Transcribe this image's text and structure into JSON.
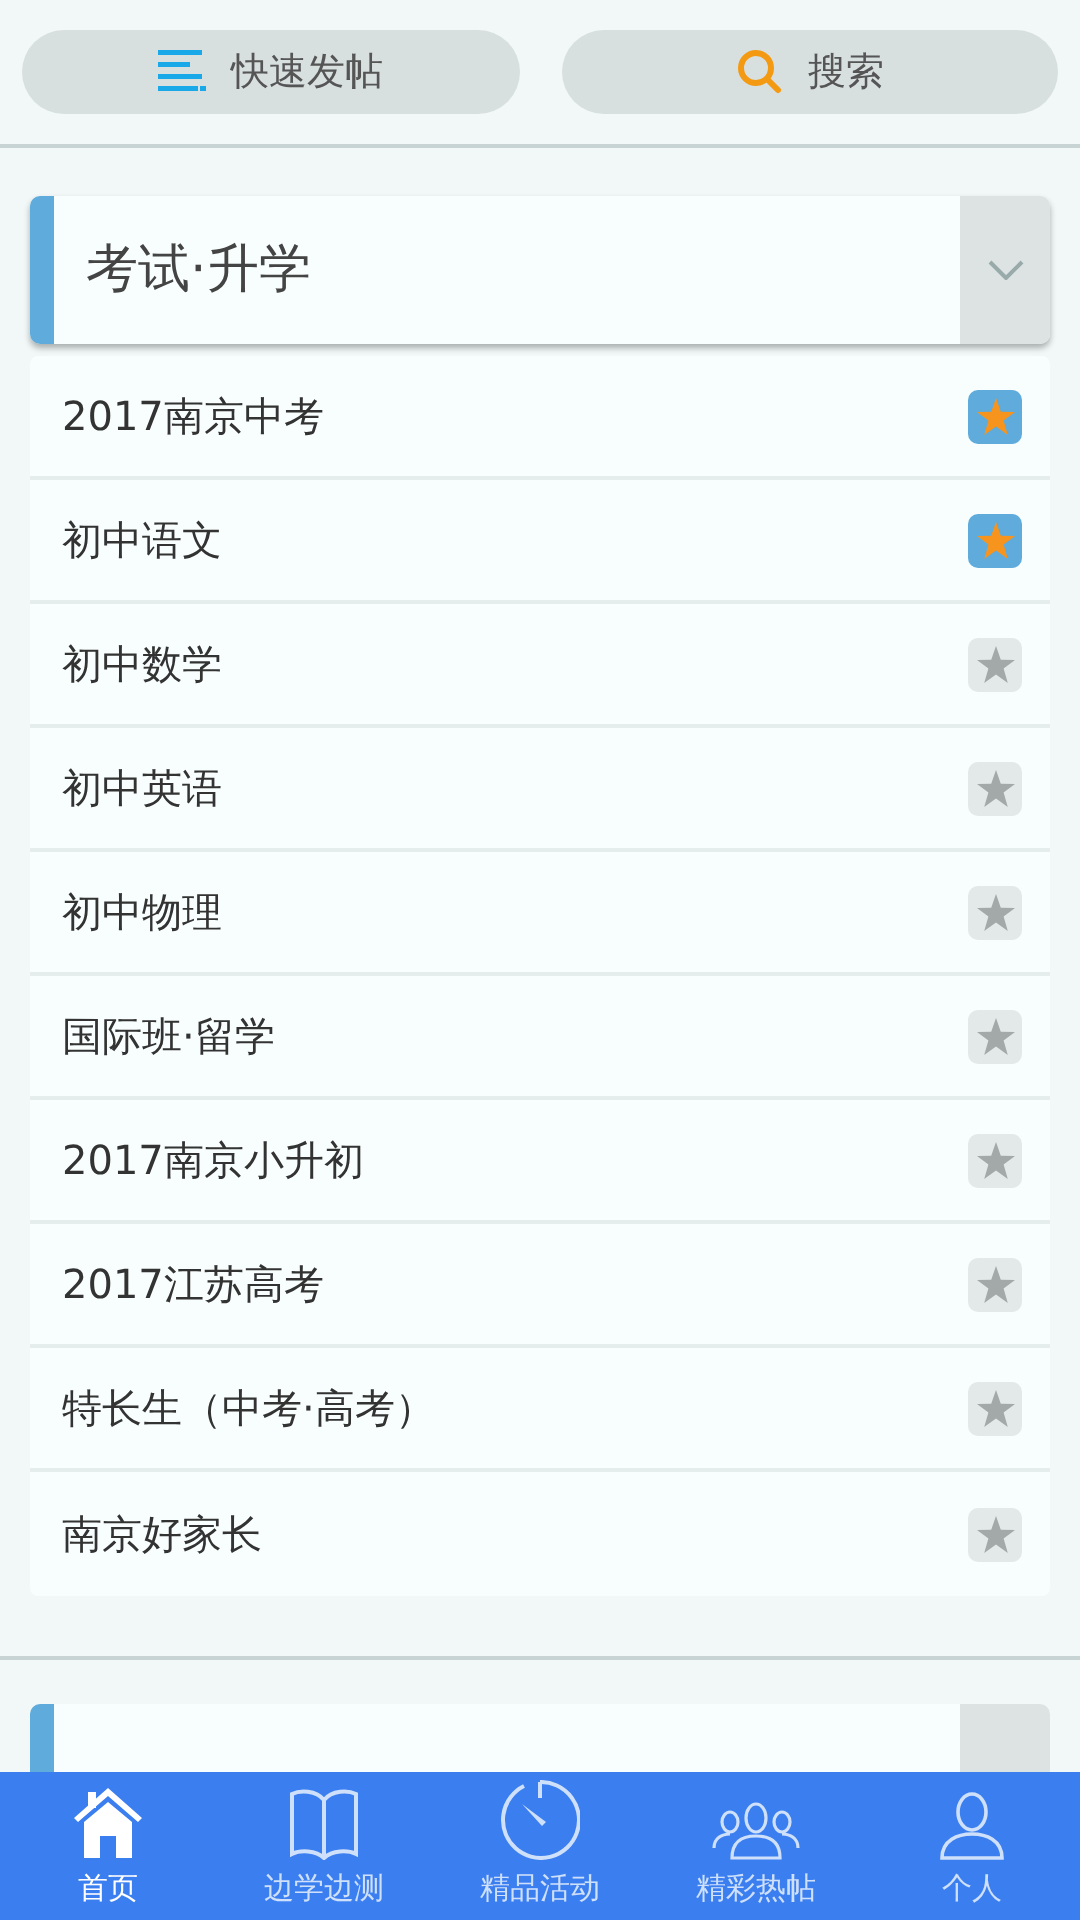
{
  "top_buttons": [
    {
      "kind": "post",
      "label": "快速发帖"
    },
    {
      "kind": "search",
      "label": "搜索"
    }
  ],
  "sections": [
    {
      "title": "考试·升学",
      "expanded": true,
      "items": [
        {
          "label": "2017南京中考",
          "starred": true
        },
        {
          "label": "初中语文",
          "starred": true
        },
        {
          "label": "初中数学",
          "starred": false
        },
        {
          "label": "初中英语",
          "starred": false
        },
        {
          "label": "初中物理",
          "starred": false
        },
        {
          "label": "国际班·留学",
          "starred": false
        },
        {
          "label": "2017南京小升初",
          "starred": false
        },
        {
          "label": "2017江苏高考",
          "starred": false
        },
        {
          "label": "特长生（中考·高考）",
          "starred": false
        },
        {
          "label": "南京好家长",
          "starred": false
        }
      ]
    },
    {
      "expanded": false
    }
  ],
  "nav": [
    {
      "kind": "home",
      "label": "首页",
      "selected": true
    },
    {
      "kind": "book",
      "label": "边学边测",
      "selected": false
    },
    {
      "kind": "timer",
      "label": "精品活动",
      "selected": false
    },
    {
      "kind": "people",
      "label": "精彩热帖",
      "selected": false
    },
    {
      "kind": "person",
      "label": "个人",
      "selected": false
    }
  ]
}
